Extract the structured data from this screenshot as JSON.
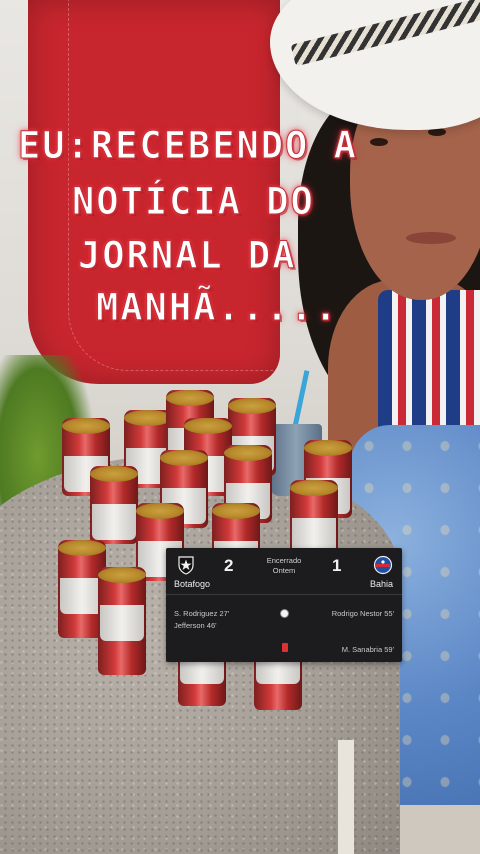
{
  "caption": {
    "lines": [
      "EU:RECEBENDO A",
      "NOTÍCIA DO",
      "JORNAL DA",
      "MANHÃ....."
    ]
  },
  "match": {
    "home": {
      "name": "Botafogo",
      "goals": "2",
      "crest_icon": "botafogo-star-crest-icon"
    },
    "away": {
      "name": "Bahia",
      "goals": "1",
      "crest_icon": "bahia-crest-icon"
    },
    "status_line1": "Encerrado",
    "status_line2": "Ontem",
    "home_events": [
      "S. Rodriguez 27'",
      "Jefferson 46'"
    ],
    "away_events": [
      "Rodrigo Nestor 55'",
      "M. Sanabria 59'"
    ],
    "event_icons": [
      "soccer-ball-icon",
      "red-card-icon"
    ]
  },
  "colors": {
    "caption_glow": "#e0283a",
    "card_bg": "#1c1c1e",
    "red_card": "#e03131"
  }
}
